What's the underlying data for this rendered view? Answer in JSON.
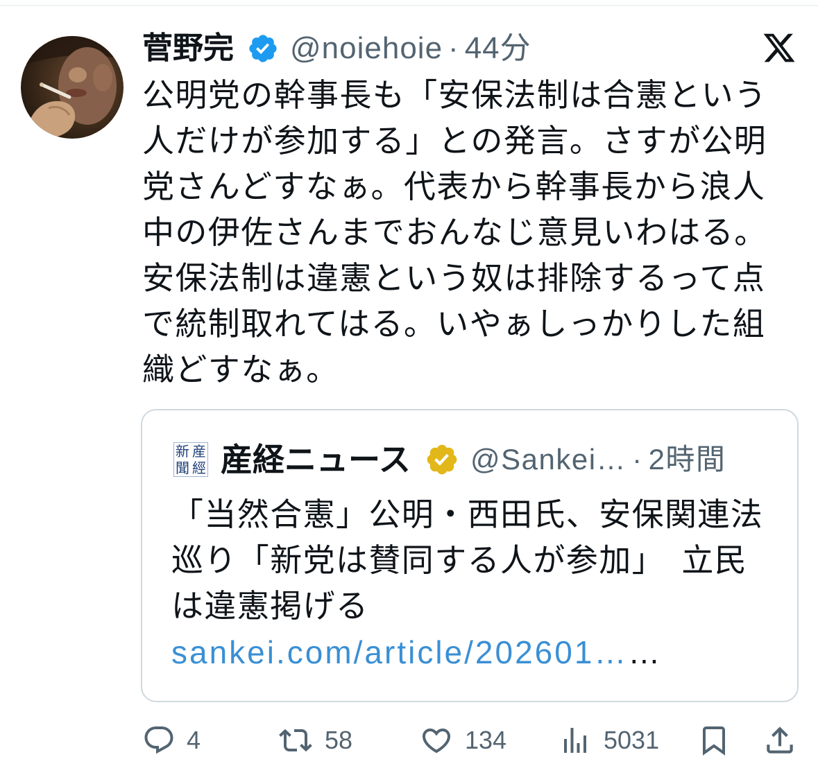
{
  "colors": {
    "text": "#0f1419",
    "secondary_text": "#536471",
    "link": "#3a8fd4",
    "verified_blue": "#1d9bf0",
    "verified_gold": "#e2b719",
    "card_border": "#cfd9de"
  },
  "icons": [
    "x-logo-icon",
    "verified-badge-icon",
    "gold-verified-badge-icon",
    "reply-icon",
    "repost-icon",
    "like-icon",
    "views-icon",
    "bookmark-icon",
    "share-icon"
  ],
  "tweet": {
    "author": {
      "name": "菅野完",
      "handle": "@noiehoie",
      "separator": "·",
      "time": "44分"
    },
    "text_lines": [
      "公明党の幹事長も「安保法制は合憲という",
      "人だけが参加する」との発言。さすが公明",
      "党さんどすなぁ。代表から幹事長から浪人",
      "中の伊佐さんまでおんなじ意見いわはる。",
      "安保法制は違憲という奴は排除するって点",
      "で統制取れてはる。いやぁしっかりした組",
      "織どすなぁ。"
    ],
    "quote": {
      "logo": {
        "top_left": "新",
        "top_right": "産",
        "bottom_left": "聞",
        "bottom_right": "經"
      },
      "author": {
        "name": "産経ニュース",
        "handle": "@Sankei…",
        "separator": "·",
        "time": "2時間"
      },
      "text_lines": [
        "「当然合憲」公明・西田氏、安保関連法",
        "巡り「新党は賛同する人が参加」　立民",
        "は違憲掲げる"
      ],
      "link": "sankei.com/article/202601…",
      "link_truncation": "…"
    },
    "actions": {
      "replies": "4",
      "reposts": "58",
      "likes": "134",
      "views": "5031"
    }
  }
}
